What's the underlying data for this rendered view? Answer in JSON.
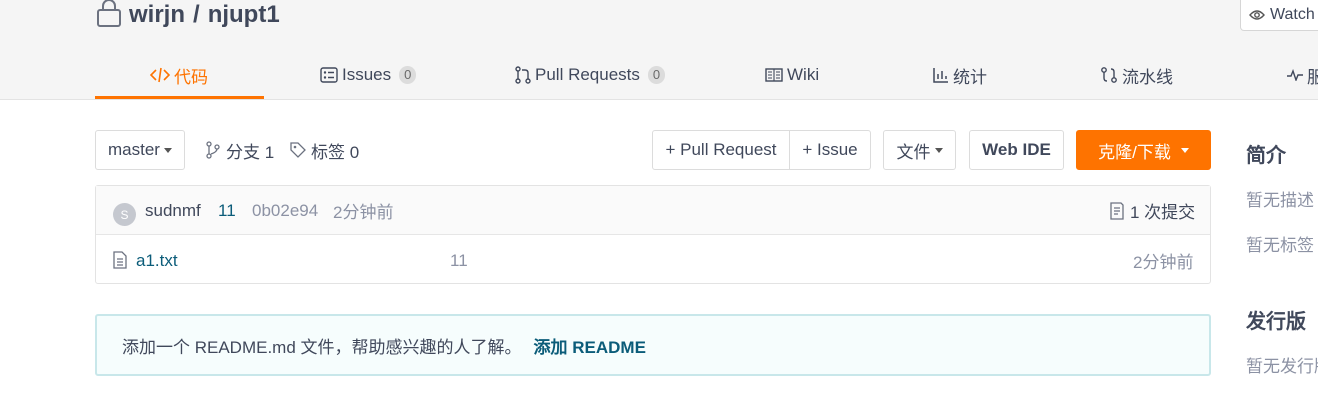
{
  "repo": {
    "owner": "wirjn",
    "separator": "/",
    "name": "njupt1",
    "watch_label": "Watch"
  },
  "tabs": [
    {
      "label": "代码",
      "icon": "code-icon",
      "active": true
    },
    {
      "label": "Issues",
      "icon": "issues-icon",
      "count": "0"
    },
    {
      "label": "Pull Requests",
      "icon": "pull-request-icon",
      "count": "0"
    },
    {
      "label": "Wiki",
      "icon": "wiki-icon"
    },
    {
      "label": "统计",
      "icon": "stats-icon"
    },
    {
      "label": "流水线",
      "icon": "pipeline-icon"
    },
    {
      "label": "服",
      "icon": "pulse-icon"
    }
  ],
  "toolbar": {
    "branch": "master",
    "branches_label": "分支 1",
    "tags_label": "标签 0",
    "new_pr": "+ Pull Request",
    "new_issue": "+ Issue",
    "file_menu": "文件",
    "web_ide": "Web IDE",
    "clone": "克隆/下载"
  },
  "commit": {
    "avatar_letter": "S",
    "author": "sudnmf",
    "message": "11",
    "sha": "0b02e94",
    "time": "2分钟前",
    "commit_count": "1 次提交"
  },
  "files": [
    {
      "name": "a1.txt",
      "message": "11",
      "time": "2分钟前"
    }
  ],
  "readme": {
    "text": "添加一个 README.md 文件，帮助感兴趣的人了解。",
    "link": "添加 README"
  },
  "sidebar": {
    "intro_title": "简介",
    "no_desc": "暂无描述",
    "no_tags": "暂无标签",
    "release_title": "发行版",
    "no_release": "暂无发行版"
  },
  "colors": {
    "accent": "#fe7300",
    "link": "#0b5c79"
  }
}
